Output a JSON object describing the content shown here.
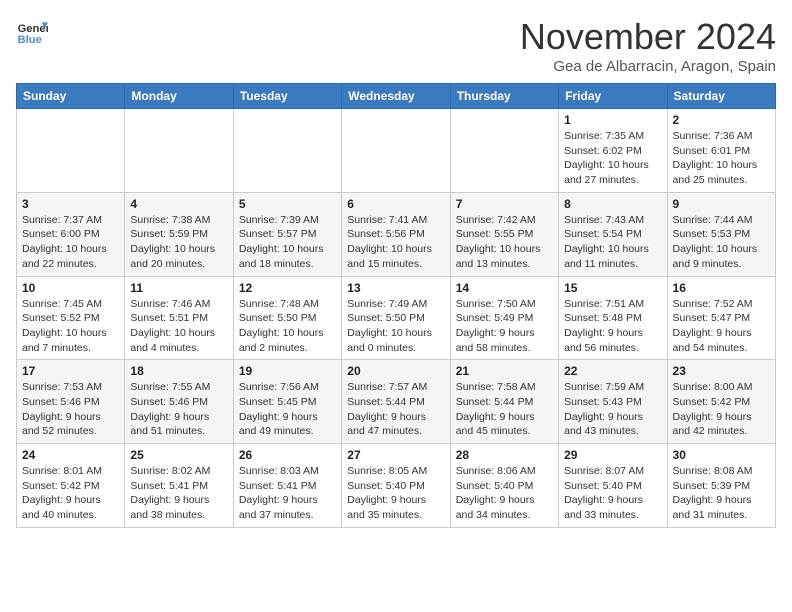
{
  "header": {
    "logo_line1": "General",
    "logo_line2": "Blue",
    "month": "November 2024",
    "location": "Gea de Albarracin, Aragon, Spain"
  },
  "days_of_week": [
    "Sunday",
    "Monday",
    "Tuesday",
    "Wednesday",
    "Thursday",
    "Friday",
    "Saturday"
  ],
  "weeks": [
    [
      {
        "day": "",
        "info": ""
      },
      {
        "day": "",
        "info": ""
      },
      {
        "day": "",
        "info": ""
      },
      {
        "day": "",
        "info": ""
      },
      {
        "day": "",
        "info": ""
      },
      {
        "day": "1",
        "info": "Sunrise: 7:35 AM\nSunset: 6:02 PM\nDaylight: 10 hours\nand 27 minutes."
      },
      {
        "day": "2",
        "info": "Sunrise: 7:36 AM\nSunset: 6:01 PM\nDaylight: 10 hours\nand 25 minutes."
      }
    ],
    [
      {
        "day": "3",
        "info": "Sunrise: 7:37 AM\nSunset: 6:00 PM\nDaylight: 10 hours\nand 22 minutes."
      },
      {
        "day": "4",
        "info": "Sunrise: 7:38 AM\nSunset: 5:59 PM\nDaylight: 10 hours\nand 20 minutes."
      },
      {
        "day": "5",
        "info": "Sunrise: 7:39 AM\nSunset: 5:57 PM\nDaylight: 10 hours\nand 18 minutes."
      },
      {
        "day": "6",
        "info": "Sunrise: 7:41 AM\nSunset: 5:56 PM\nDaylight: 10 hours\nand 15 minutes."
      },
      {
        "day": "7",
        "info": "Sunrise: 7:42 AM\nSunset: 5:55 PM\nDaylight: 10 hours\nand 13 minutes."
      },
      {
        "day": "8",
        "info": "Sunrise: 7:43 AM\nSunset: 5:54 PM\nDaylight: 10 hours\nand 11 minutes."
      },
      {
        "day": "9",
        "info": "Sunrise: 7:44 AM\nSunset: 5:53 PM\nDaylight: 10 hours\nand 9 minutes."
      }
    ],
    [
      {
        "day": "10",
        "info": "Sunrise: 7:45 AM\nSunset: 5:52 PM\nDaylight: 10 hours\nand 7 minutes."
      },
      {
        "day": "11",
        "info": "Sunrise: 7:46 AM\nSunset: 5:51 PM\nDaylight: 10 hours\nand 4 minutes."
      },
      {
        "day": "12",
        "info": "Sunrise: 7:48 AM\nSunset: 5:50 PM\nDaylight: 10 hours\nand 2 minutes."
      },
      {
        "day": "13",
        "info": "Sunrise: 7:49 AM\nSunset: 5:50 PM\nDaylight: 10 hours\nand 0 minutes."
      },
      {
        "day": "14",
        "info": "Sunrise: 7:50 AM\nSunset: 5:49 PM\nDaylight: 9 hours\nand 58 minutes."
      },
      {
        "day": "15",
        "info": "Sunrise: 7:51 AM\nSunset: 5:48 PM\nDaylight: 9 hours\nand 56 minutes."
      },
      {
        "day": "16",
        "info": "Sunrise: 7:52 AM\nSunset: 5:47 PM\nDaylight: 9 hours\nand 54 minutes."
      }
    ],
    [
      {
        "day": "17",
        "info": "Sunrise: 7:53 AM\nSunset: 5:46 PM\nDaylight: 9 hours\nand 52 minutes."
      },
      {
        "day": "18",
        "info": "Sunrise: 7:55 AM\nSunset: 5:46 PM\nDaylight: 9 hours\nand 51 minutes."
      },
      {
        "day": "19",
        "info": "Sunrise: 7:56 AM\nSunset: 5:45 PM\nDaylight: 9 hours\nand 49 minutes."
      },
      {
        "day": "20",
        "info": "Sunrise: 7:57 AM\nSunset: 5:44 PM\nDaylight: 9 hours\nand 47 minutes."
      },
      {
        "day": "21",
        "info": "Sunrise: 7:58 AM\nSunset: 5:44 PM\nDaylight: 9 hours\nand 45 minutes."
      },
      {
        "day": "22",
        "info": "Sunrise: 7:59 AM\nSunset: 5:43 PM\nDaylight: 9 hours\nand 43 minutes."
      },
      {
        "day": "23",
        "info": "Sunrise: 8:00 AM\nSunset: 5:42 PM\nDaylight: 9 hours\nand 42 minutes."
      }
    ],
    [
      {
        "day": "24",
        "info": "Sunrise: 8:01 AM\nSunset: 5:42 PM\nDaylight: 9 hours\nand 40 minutes."
      },
      {
        "day": "25",
        "info": "Sunrise: 8:02 AM\nSunset: 5:41 PM\nDaylight: 9 hours\nand 38 minutes."
      },
      {
        "day": "26",
        "info": "Sunrise: 8:03 AM\nSunset: 5:41 PM\nDaylight: 9 hours\nand 37 minutes."
      },
      {
        "day": "27",
        "info": "Sunrise: 8:05 AM\nSunset: 5:40 PM\nDaylight: 9 hours\nand 35 minutes."
      },
      {
        "day": "28",
        "info": "Sunrise: 8:06 AM\nSunset: 5:40 PM\nDaylight: 9 hours\nand 34 minutes."
      },
      {
        "day": "29",
        "info": "Sunrise: 8:07 AM\nSunset: 5:40 PM\nDaylight: 9 hours\nand 33 minutes."
      },
      {
        "day": "30",
        "info": "Sunrise: 8:08 AM\nSunset: 5:39 PM\nDaylight: 9 hours\nand 31 minutes."
      }
    ]
  ]
}
